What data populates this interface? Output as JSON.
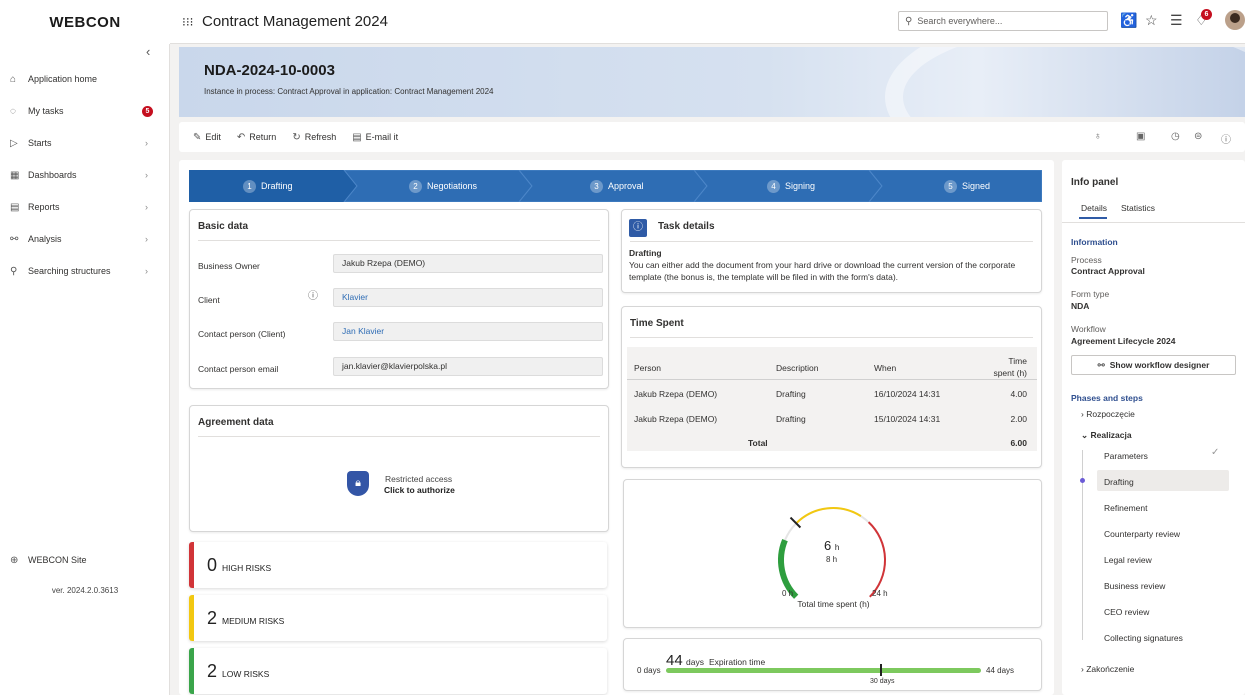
{
  "brand": {
    "logo": "WEBCON"
  },
  "header": {
    "app_title": "Contract Management 2024",
    "search_placeholder": "Search everywhere...",
    "notifications_count": "6"
  },
  "sidebar": {
    "items": [
      {
        "label": "Application home",
        "icon": "home-icon",
        "badge": ""
      },
      {
        "label": "My tasks",
        "icon": "bell-icon",
        "badge": "5"
      },
      {
        "label": "Starts",
        "icon": "play-icon",
        "badge": ""
      },
      {
        "label": "Dashboards",
        "icon": "grid-icon",
        "badge": ""
      },
      {
        "label": "Reports",
        "icon": "report-icon",
        "badge": ""
      },
      {
        "label": "Analysis",
        "icon": "analysis-icon",
        "badge": ""
      },
      {
        "label": "Searching structures",
        "icon": "structure-icon",
        "badge": ""
      }
    ],
    "site_link": "WEBCON Site",
    "version": "ver. 2024.2.0.3613"
  },
  "document": {
    "title": "NDA-2024-10-0003",
    "subtitle": "Instance in process: Contract Approval in application: Contract Management 2024"
  },
  "toolbar": {
    "edit": "Edit",
    "return": "Return",
    "refresh": "Refresh",
    "email": "E-mail it"
  },
  "steps": [
    {
      "num": "1",
      "label": "Drafting"
    },
    {
      "num": "2",
      "label": "Negotiations"
    },
    {
      "num": "3",
      "label": "Approval"
    },
    {
      "num": "4",
      "label": "Signing"
    },
    {
      "num": "5",
      "label": "Signed"
    }
  ],
  "basic_data": {
    "title": "Basic data",
    "fields": [
      {
        "label": "Business Owner",
        "value": "Jakub Rzepa (DEMO)"
      },
      {
        "label": "Client",
        "value": "Klavier"
      },
      {
        "label": "Contact person (Client)",
        "value": "Jan Klavier"
      },
      {
        "label": "Contact person email",
        "value": "jan.klavier@klavierpolska.pl"
      }
    ]
  },
  "agreement": {
    "title": "Agreement data",
    "restricted": "Restricted access",
    "authorize": "Click to authorize"
  },
  "risks": [
    {
      "count": "0",
      "label": "High risks",
      "color": "#d13438"
    },
    {
      "count": "2",
      "label": "Medium risks",
      "color": "#f2c811"
    },
    {
      "count": "2",
      "label": "Low risks",
      "color": "#3aa54a"
    }
  ],
  "task": {
    "title": "Task details",
    "step": "Drafting",
    "text": "You can either add the document from your hard drive or download the current version of the corporate template (the bonus is, the template will be filed in with the form's data)."
  },
  "time_spent": {
    "title": "Time Spent",
    "headers": {
      "person": "Person",
      "description": "Description",
      "when": "When",
      "time1": "Time",
      "time2": "spent (h)"
    },
    "rows": [
      {
        "person": "Jakub Rzepa (DEMO)",
        "description": "Drafting",
        "when": "16/10/2024 14:31",
        "time": "4.00"
      },
      {
        "person": "Jakub Rzepa (DEMO)",
        "description": "Drafting",
        "when": "15/10/2024 14:31",
        "time": "2.00"
      }
    ],
    "total_label": "Total",
    "total": "6.00"
  },
  "gauge": {
    "value": "6",
    "unit": "h",
    "target": "8 h",
    "min": "0 h",
    "max": "24 h",
    "label": "Total time spent (h)",
    "fraction": 0.25
  },
  "expiration": {
    "value": "44",
    "unit": "days",
    "label": "Expiration time",
    "min": "0 days",
    "max": "44 days",
    "marker": "30 days",
    "fraction": 1.0,
    "marker_fraction": 0.68
  },
  "info_panel": {
    "title": "Info panel",
    "tabs": [
      "Details",
      "Statistics"
    ],
    "information_title": "Information",
    "process_label": "Process",
    "process_value": "Contract Approval",
    "form_type_label": "Form type",
    "form_type_value": "NDA",
    "workflow_label": "Workflow",
    "workflow_value": "Agreement Lifecycle 2024",
    "designer_button": "Show workflow designer",
    "phases_title": "Phases and steps",
    "phase_rozpoczecie": "Rozpoczęcie",
    "phase_realizacja": "Realizacja",
    "phase_zakonczenie": "Zakończenie",
    "phase_steps": [
      "Parameters",
      "Drafting",
      "Refinement",
      "Counterparty review",
      "Legal review",
      "Business review",
      "CEO review",
      "Collecting signatures"
    ]
  }
}
